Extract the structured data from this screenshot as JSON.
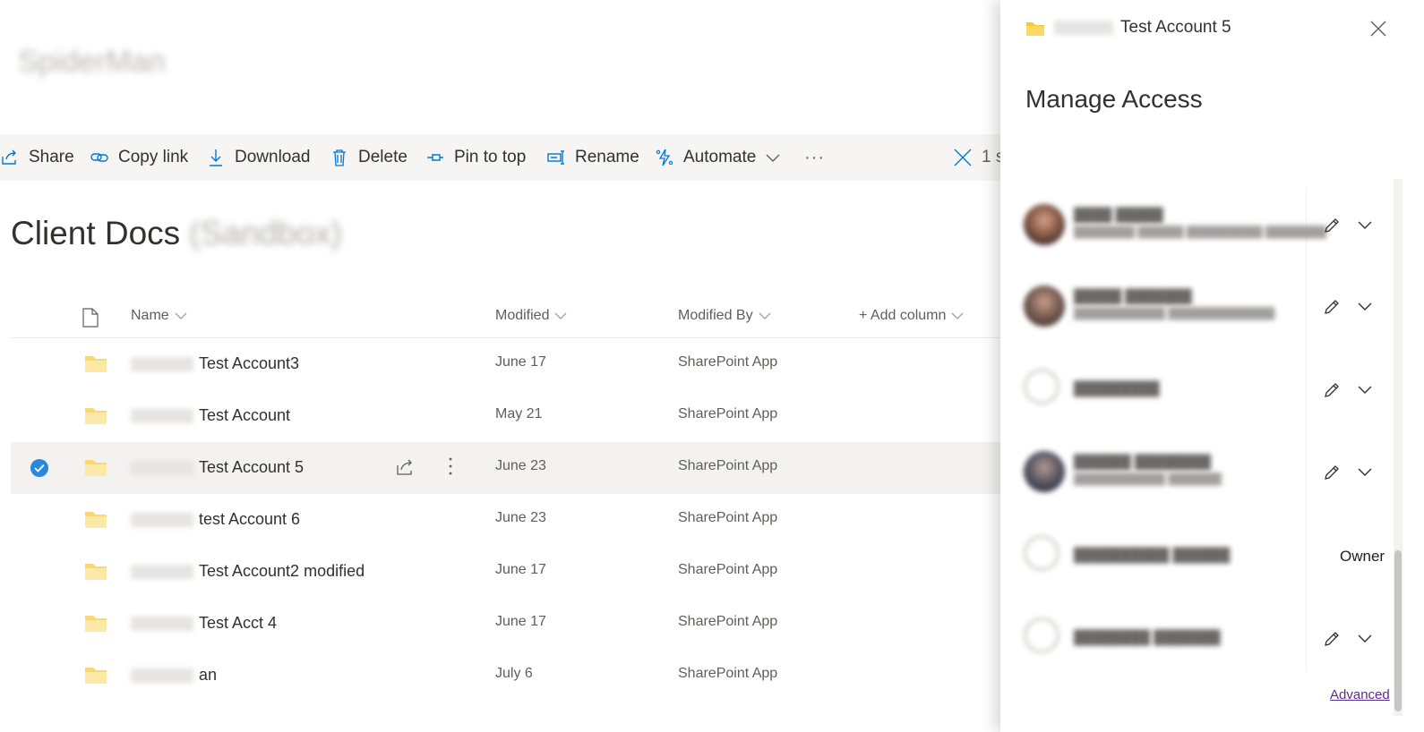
{
  "site": {
    "title": "SpiderMan"
  },
  "command_bar": {
    "share": "Share",
    "copy_link": "Copy link",
    "download": "Download",
    "delete": "Delete",
    "pin_to_top": "Pin to top",
    "rename": "Rename",
    "automate": "Automate",
    "more": "···",
    "selection": "1 s"
  },
  "library": {
    "title": "Client Docs",
    "suffix": "(Sandbox)"
  },
  "columns": {
    "name": "Name",
    "modified": "Modified",
    "modified_by": "Modified By",
    "add_column": "+ Add column"
  },
  "rows": [
    {
      "name": "Test Account3",
      "modified": "June 17",
      "modified_by": "SharePoint App"
    },
    {
      "name": "Test Account",
      "modified": "May 21",
      "modified_by": "SharePoint App"
    },
    {
      "name": "Test Account 5",
      "modified": "June 23",
      "modified_by": "SharePoint App"
    },
    {
      "name": "test Account 6",
      "modified": "June 23",
      "modified_by": "SharePoint App"
    },
    {
      "name": "Test Account2 modified",
      "modified": "June 17",
      "modified_by": "SharePoint App"
    },
    {
      "name": "Test Acct 4",
      "modified": "June 17",
      "modified_by": "SharePoint App"
    },
    {
      "name": "an",
      "modified": "July 6",
      "modified_by": "SharePoint App"
    }
  ],
  "panel": {
    "folder_name": "Test Account 5",
    "heading": "Manage Access",
    "people": [
      {
        "role": ""
      },
      {
        "role": ""
      },
      {
        "role": ""
      },
      {
        "role": ""
      },
      {
        "role": "Owner"
      },
      {
        "role": ""
      }
    ],
    "advanced": "Advanced"
  },
  "colors": {
    "folder": "#f8d775",
    "accent": "#0078d4",
    "selected_row": "#f3f2f1",
    "link": "#5c2d91"
  }
}
